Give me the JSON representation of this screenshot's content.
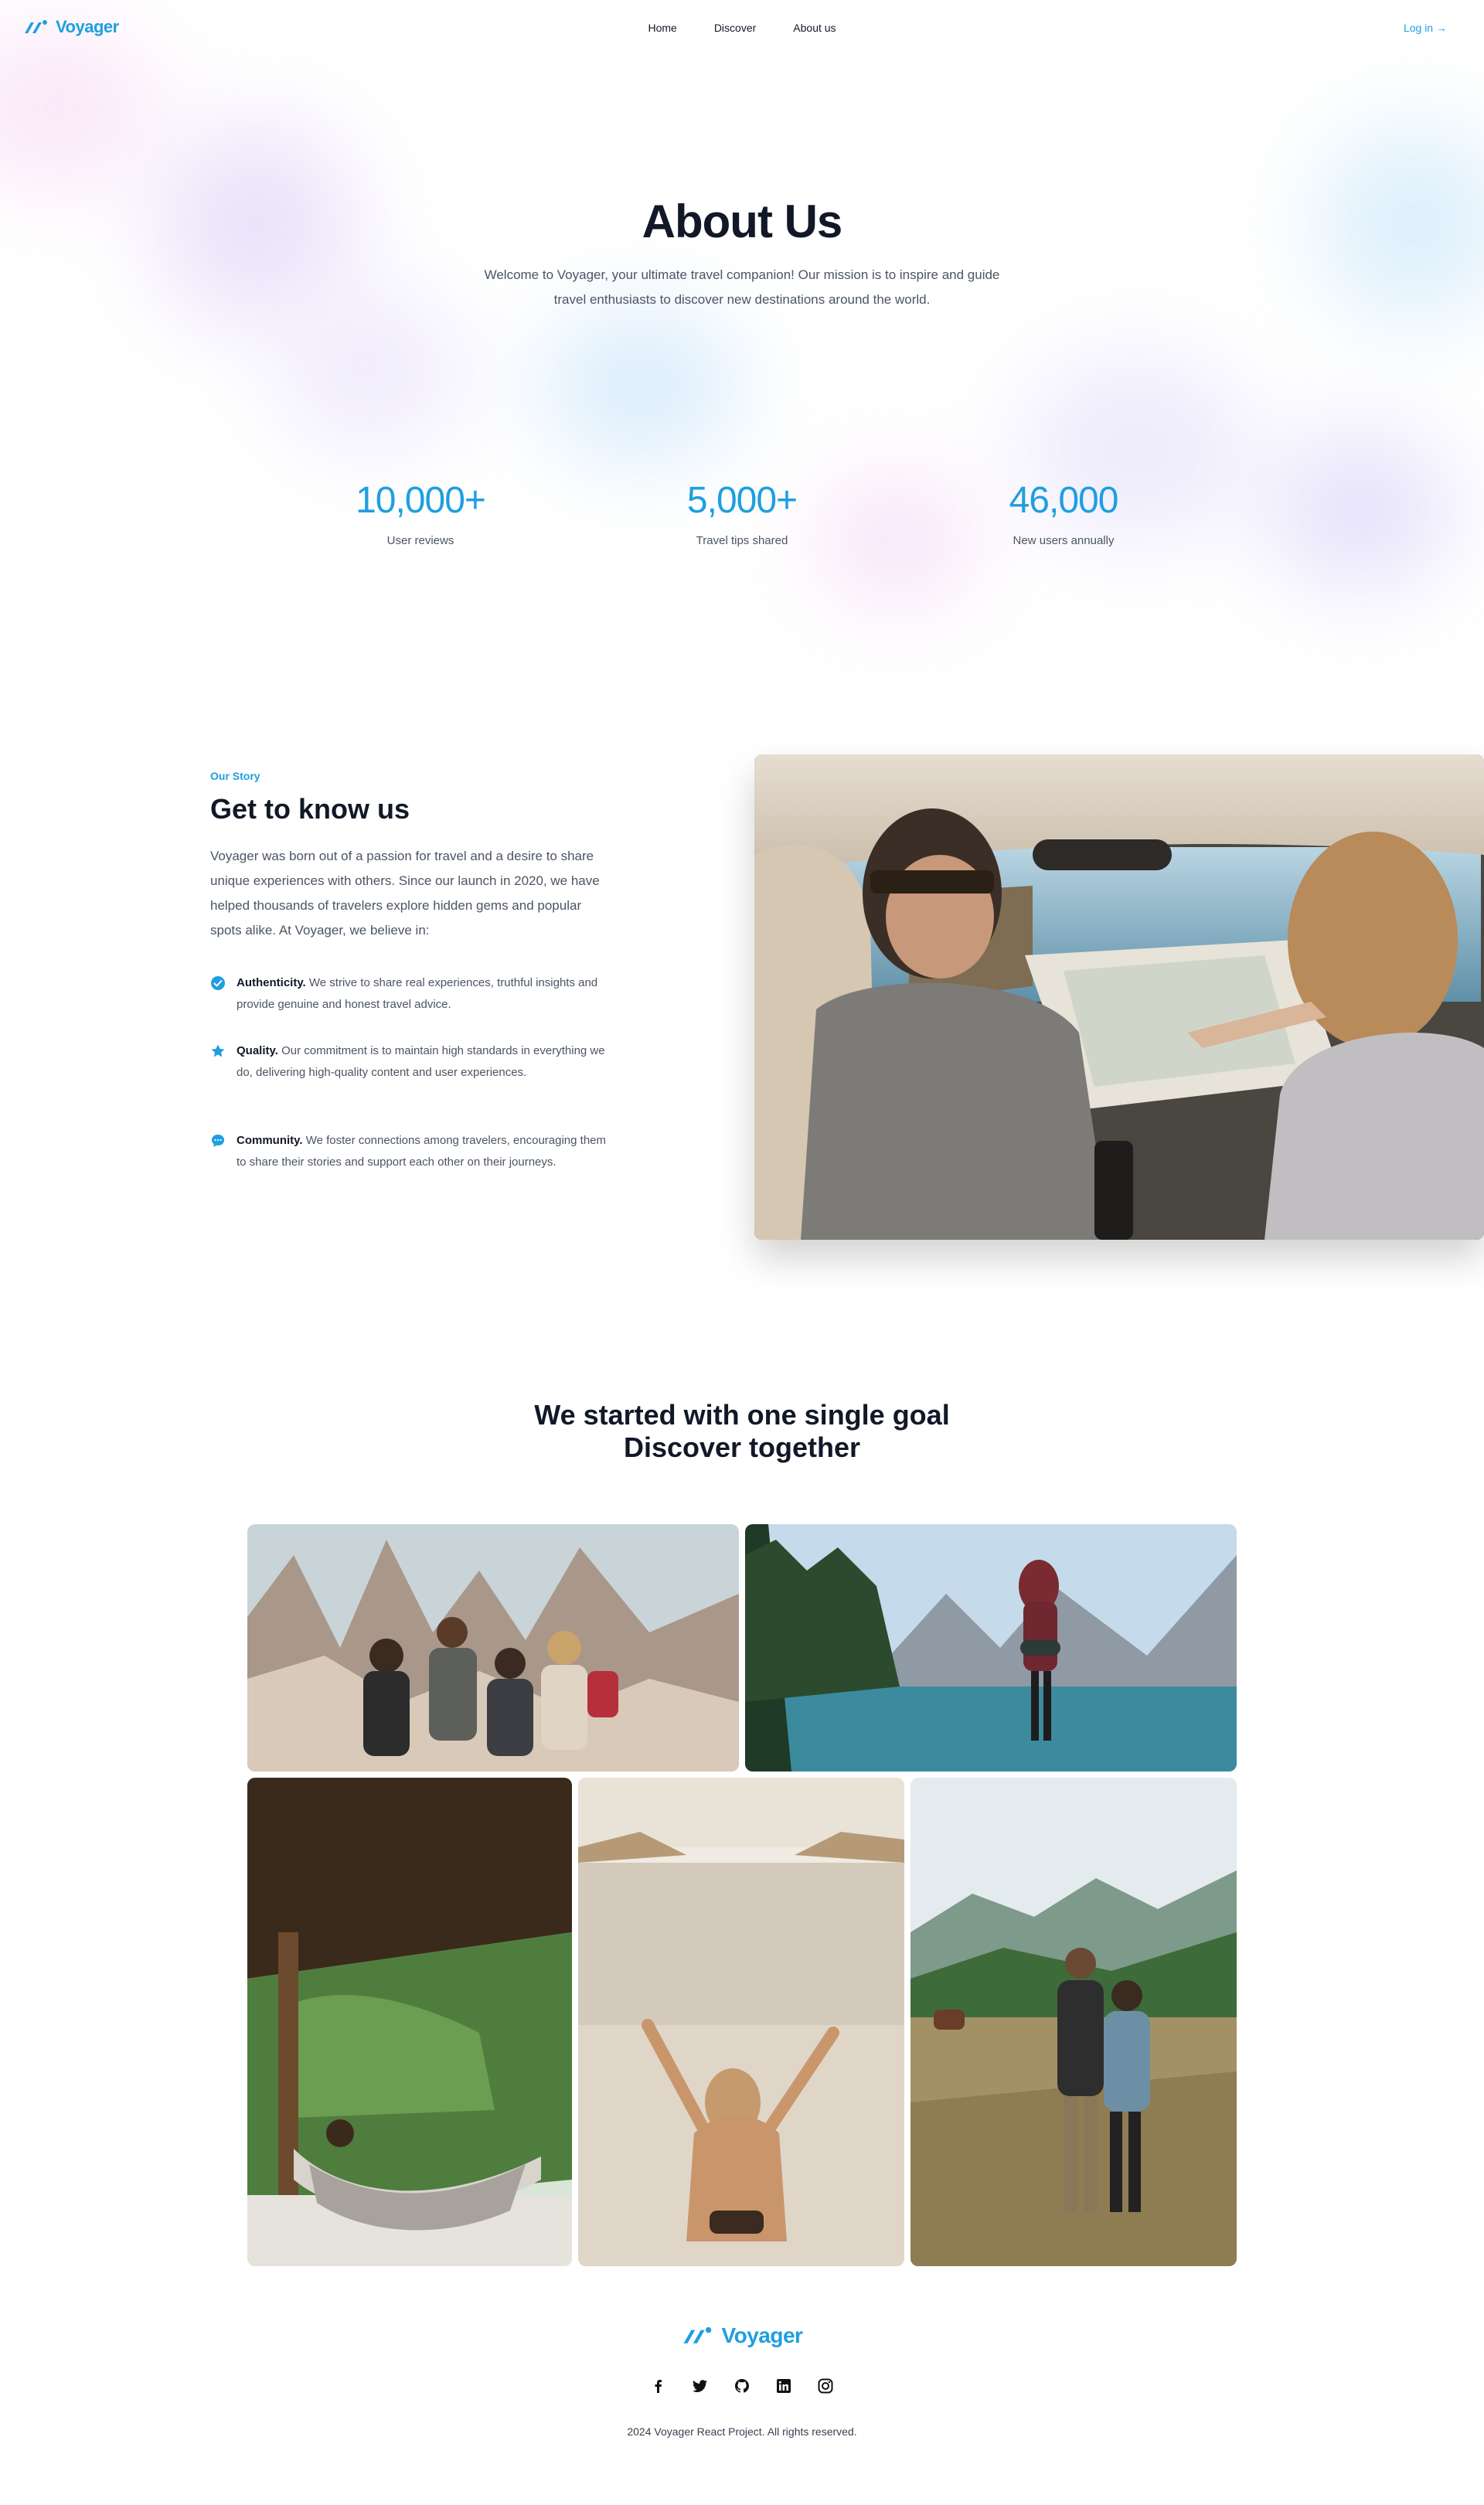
{
  "brand": {
    "name": "Voyager",
    "color": "#1e9fe0"
  },
  "nav": {
    "links": [
      "Home",
      "Discover",
      "About us"
    ],
    "login": "Log in →"
  },
  "hero": {
    "title": "About Us",
    "subtitle": "Welcome to Voyager, your ultimate travel companion! Our mission is to inspire and guide travel enthusiasts to discover new destinations around the world."
  },
  "stats": [
    {
      "value": "10,000+",
      "label": "User reviews"
    },
    {
      "value": "5,000+",
      "label": "Travel tips shared"
    },
    {
      "value": "46,000",
      "label": "New users annually"
    }
  ],
  "story": {
    "eyebrow": "Our Story",
    "title": "Get to know us",
    "text": "Voyager was born out of a passion for travel and a desire to share unique experiences with others. Since our launch in 2020, we have helped thousands of travelers explore hidden gems and popular spots alike. At Voyager, we believe in:",
    "features": [
      {
        "icon": "check-circle-icon",
        "title": "Authenticity.",
        "text": "We strive to share real experiences, truthful insights and provide genuine and honest travel advice."
      },
      {
        "icon": "star-icon",
        "title": "Quality.",
        "text": "Our commitment is to maintain high standards in everything we do, delivering high-quality content and user experiences."
      },
      {
        "icon": "chat-bubble-icon",
        "title": "Community.",
        "text": "We foster connections among travelers, encouraging them to share their stories and support each other on their journeys."
      }
    ]
  },
  "goal": {
    "line1": "We started with one single goal",
    "line2": "Discover together"
  },
  "footer": {
    "brand": "Voyager",
    "socials": [
      "facebook-icon",
      "twitter-icon",
      "github-icon",
      "linkedin-icon",
      "instagram-icon"
    ],
    "copyright": "2024 Voyager React Project. All rights reserved."
  }
}
